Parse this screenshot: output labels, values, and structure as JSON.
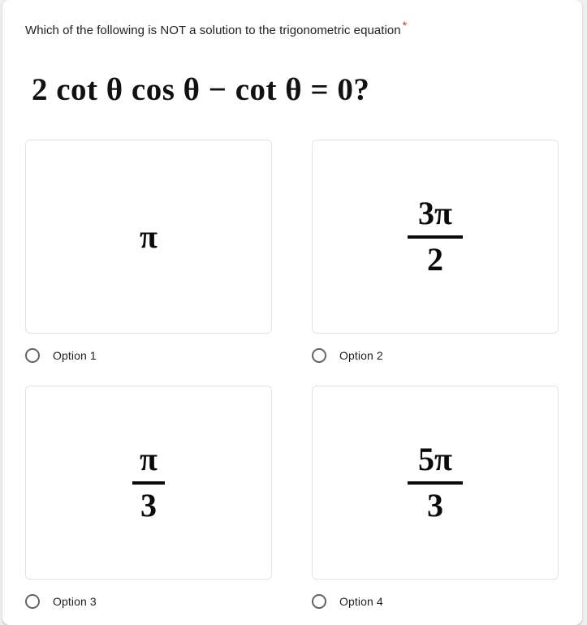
{
  "form": {
    "question": {
      "prompt": "Which of the following is NOT a solution to the trigonometric equation",
      "required_marker": "*",
      "required_color": "#d93025",
      "equation": "2 cot θ cos θ − cot θ = 0?"
    },
    "options": [
      {
        "label": "Option 1",
        "value_display": "π",
        "value_type": "plain",
        "numerator": "π",
        "denominator": "",
        "selected": false
      },
      {
        "label": "Option 2",
        "value_display": "3π/2",
        "value_type": "fraction",
        "numerator": "3π",
        "denominator": "2",
        "selected": false
      },
      {
        "label": "Option 3",
        "value_display": "π/3",
        "value_type": "fraction",
        "numerator": "π",
        "denominator": "3",
        "selected": false
      },
      {
        "label": "Option 4",
        "value_display": "5π/3",
        "value_type": "fraction",
        "numerator": "5π",
        "denominator": "3",
        "selected": false
      }
    ]
  },
  "theme": {
    "page_background": "#ffffff",
    "text_color": "#202124",
    "card_border": "#e3e3e3",
    "radio_border": "#5f6368",
    "math_color": "#0a0a0a"
  }
}
